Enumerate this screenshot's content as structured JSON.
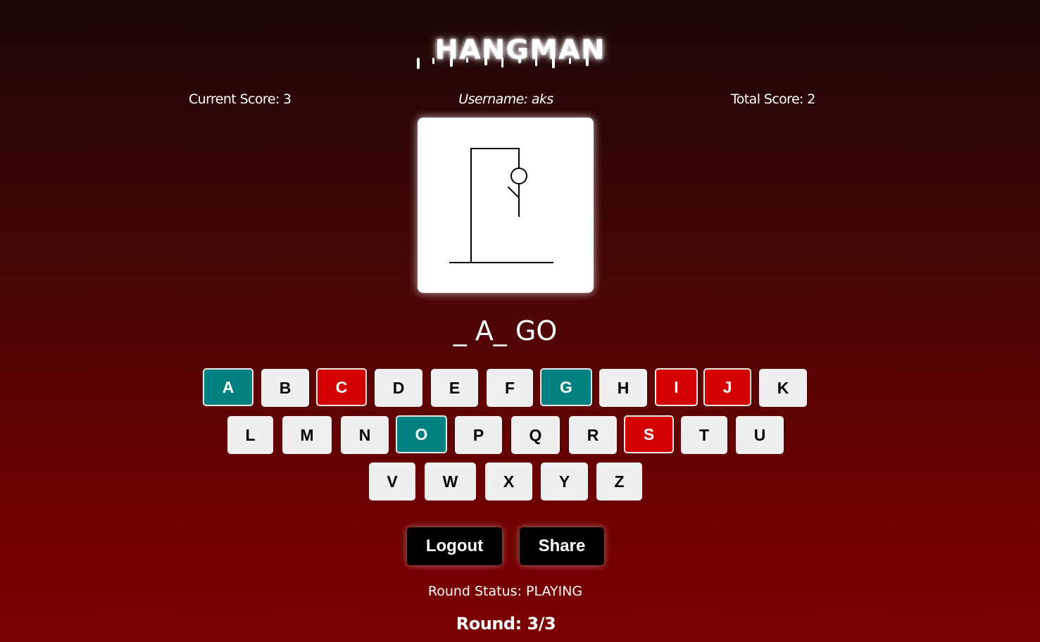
{
  "title": "HANGMAN",
  "scores": {
    "current": "Current Score: 3",
    "username": "Username: aks",
    "total": "Total Score: 2"
  },
  "word_display": "_ A_ GO",
  "keyboard": {
    "row1": [
      {
        "letter": "A",
        "state": "correct"
      },
      {
        "letter": "B",
        "state": "unused"
      },
      {
        "letter": "C",
        "state": "wrong"
      },
      {
        "letter": "D",
        "state": "unused"
      },
      {
        "letter": "E",
        "state": "unused"
      },
      {
        "letter": "F",
        "state": "unused"
      },
      {
        "letter": "G",
        "state": "correct"
      },
      {
        "letter": "H",
        "state": "unused"
      },
      {
        "letter": "I",
        "state": "wrong"
      },
      {
        "letter": "J",
        "state": "wrong"
      },
      {
        "letter": "K",
        "state": "unused"
      }
    ],
    "row2": [
      {
        "letter": "L",
        "state": "unused"
      },
      {
        "letter": "M",
        "state": "unused"
      },
      {
        "letter": "N",
        "state": "unused"
      },
      {
        "letter": "O",
        "state": "correct"
      },
      {
        "letter": "P",
        "state": "unused"
      },
      {
        "letter": "Q",
        "state": "unused"
      },
      {
        "letter": "R",
        "state": "unused"
      },
      {
        "letter": "S",
        "state": "wrong"
      },
      {
        "letter": "T",
        "state": "unused"
      },
      {
        "letter": "U",
        "state": "unused"
      }
    ],
    "row3": [
      {
        "letter": "V",
        "state": "unused"
      },
      {
        "letter": "W",
        "state": "unused"
      },
      {
        "letter": "X",
        "state": "unused"
      },
      {
        "letter": "Y",
        "state": "unused"
      },
      {
        "letter": "Z",
        "state": "unused"
      }
    ]
  },
  "buttons": {
    "logout": "Logout",
    "share": "Share"
  },
  "round_status": "Round Status: PLAYING",
  "round": "Round: 3/3",
  "hangman": {
    "parts_shown": [
      "head",
      "body",
      "left-arm"
    ]
  },
  "colors": {
    "correct": "#008080",
    "wrong": "#d40000",
    "unused": "#efefef"
  }
}
